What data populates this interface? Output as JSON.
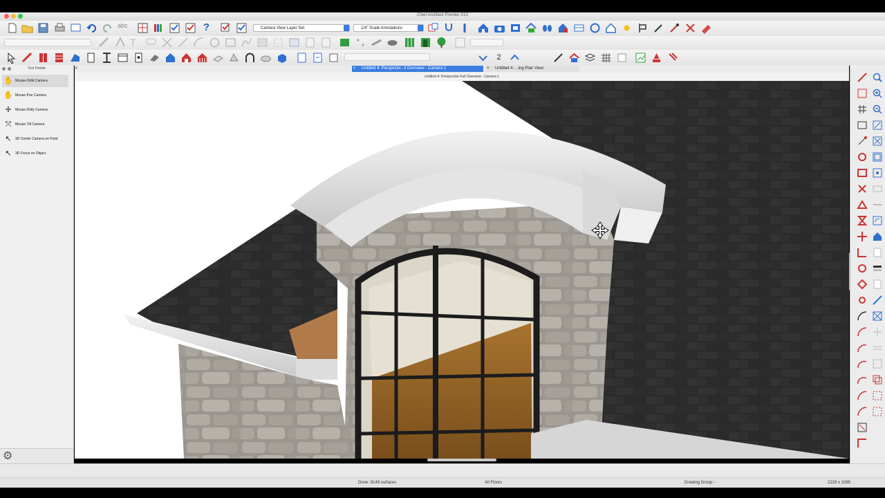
{
  "app": {
    "title": "Chief Architect Premier X10"
  },
  "toolbar": {
    "layer_set": "Camera View Layer Set",
    "annotation_set": "1/4\" Scale Annotations",
    "floor_number": "2"
  },
  "tabs": [
    {
      "label": "Untitled 4: Perspectiv...ll Overview - Camera 1",
      "active": true
    },
    {
      "label": "Untitled 4: ...ing Plan View",
      "active": false
    }
  ],
  "view": {
    "header": "Untitled 4: Perspective Full Overview - Camera 1"
  },
  "palette": {
    "title": "Tool Palette",
    "items": [
      {
        "label": "Mouse-Orbit Camera",
        "icon": "orbit-hand-icon"
      },
      {
        "label": "Mouse-Pan Camera",
        "icon": "pan-hand-icon"
      },
      {
        "label": "Mouse-Dolly Camera",
        "icon": "dolly-icon"
      },
      {
        "label": "Mouse-Tilt Camera",
        "icon": "tilt-icon"
      },
      {
        "label": "3D Center Camera on Point",
        "icon": "center-point-icon"
      },
      {
        "label": "3D Focus on Object",
        "icon": "focus-object-icon"
      }
    ]
  },
  "status": {
    "done": "Done:  9149 surfaces",
    "floors": "All Floors",
    "drawing_group": "Drawing Group: -",
    "size": "2229 x 1085"
  },
  "colors": {
    "accent": "#3b7de0",
    "roof": "#2b2b2b",
    "stone": "#a7a39b",
    "wood": "#9a6a2f"
  }
}
